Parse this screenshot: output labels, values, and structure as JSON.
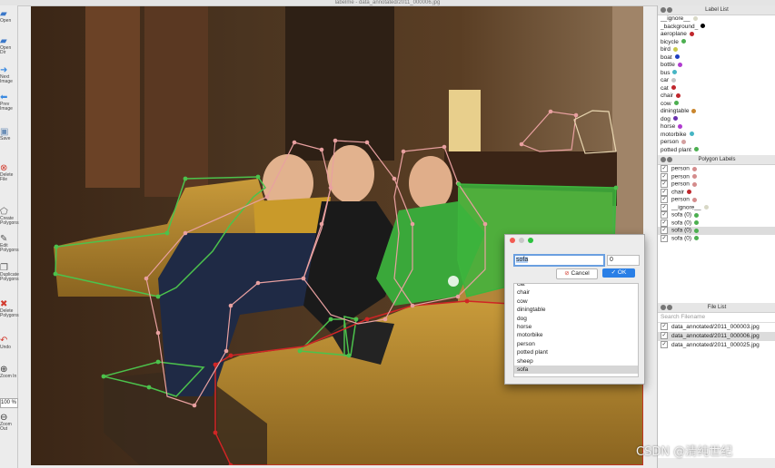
{
  "window": {
    "title": "labelme - data_annotated/2011_000006.jpg"
  },
  "toolbar": {
    "items": [
      {
        "label": "Open",
        "icon": "folder-icon",
        "color": "#3b78c9"
      },
      {
        "label": "Open Dir",
        "icon": "folder-icon",
        "color": "#3b78c9"
      },
      {
        "label": "Next Image",
        "icon": "arrow-right-icon",
        "color": "#3b8ae0"
      },
      {
        "label": "Prev Image",
        "icon": "arrow-left-icon",
        "color": "#3b8ae0"
      },
      {
        "label": "Save",
        "icon": "save-icon",
        "color": "#6c8fb7"
      },
      {
        "label": "Delete File",
        "icon": "delete-file-icon",
        "color": "#d23c2f"
      },
      {
        "label": "Create Polygons",
        "icon": "polygon-icon",
        "color": "#555"
      },
      {
        "label": "Edit Polygons",
        "icon": "edit-icon",
        "color": "#555"
      },
      {
        "label": "Duplicate Polygons",
        "icon": "copy-icon",
        "color": "#555"
      },
      {
        "label": "Delete Polygons",
        "icon": "cross-icon",
        "color": "#d23c2f"
      },
      {
        "label": "Undo",
        "icon": "undo-icon",
        "color": "#d23c2f"
      },
      {
        "label": "Zoom In",
        "icon": "zoom-in-icon",
        "color": "#333"
      },
      {
        "label": "Zoom Out",
        "icon": "zoom-out-icon",
        "color": "#333"
      }
    ],
    "zoom_value": "100 %"
  },
  "label_list": {
    "title": "Label List",
    "items": [
      {
        "label": "__ignore__",
        "color": "#d8d8c6"
      },
      {
        "label": "_background_",
        "color": "#000000"
      },
      {
        "label": "aeroplane",
        "color": "#c0272d"
      },
      {
        "label": "bicycle",
        "color": "#4caf50"
      },
      {
        "label": "bird",
        "color": "#c9c94a"
      },
      {
        "label": "boat",
        "color": "#1f3fbf"
      },
      {
        "label": "bottle",
        "color": "#b03bd0"
      },
      {
        "label": "bus",
        "color": "#46b5c4"
      },
      {
        "label": "car",
        "color": "#c4c4c4"
      },
      {
        "label": "cat",
        "color": "#c0272d"
      },
      {
        "label": "chair",
        "color": "#c0272d"
      },
      {
        "label": "cow",
        "color": "#4caf50"
      },
      {
        "label": "diningtable",
        "color": "#c9862d"
      },
      {
        "label": "dog",
        "color": "#6a2fae"
      },
      {
        "label": "horse",
        "color": "#b03bd0"
      },
      {
        "label": "motorbike",
        "color": "#46b5c4"
      },
      {
        "label": "person",
        "color": "#d4a0a0"
      },
      {
        "label": "potted plant",
        "color": "#4caf50"
      }
    ]
  },
  "polygon_labels": {
    "title": "Polygon Labels",
    "items": [
      {
        "label": "person",
        "color": "#d48c8c",
        "checked": true
      },
      {
        "label": "person",
        "color": "#d48c8c",
        "checked": true
      },
      {
        "label": "person",
        "color": "#d48c8c",
        "checked": true
      },
      {
        "label": "chair",
        "color": "#c0272d",
        "checked": true
      },
      {
        "label": "person",
        "color": "#d48c8c",
        "checked": true
      },
      {
        "label": "__ignore__",
        "color": "#d8d8c6",
        "checked": true
      },
      {
        "label": "sofa (0)",
        "color": "#4caf50",
        "checked": true
      },
      {
        "label": "sofa (0)",
        "color": "#4caf50",
        "checked": true
      },
      {
        "label": "sofa (0)",
        "color": "#4caf50",
        "checked": true,
        "selected": true
      },
      {
        "label": "sofa (0)",
        "color": "#4caf50",
        "checked": true
      }
    ]
  },
  "file_list": {
    "title": "File List",
    "search_placeholder": "Search Filename",
    "items": [
      {
        "label": "data_annotated/2011_000003.jpg",
        "checked": true
      },
      {
        "label": "data_annotated/2011_000006.jpg",
        "checked": true,
        "selected": true
      },
      {
        "label": "data_annotated/2011_000025.jpg",
        "checked": true
      }
    ]
  },
  "dialog": {
    "input_value": "sofa",
    "group_id": "0",
    "cancel_label": "Cancel",
    "ok_label": "OK",
    "options": [
      "cat",
      "chair",
      "cow",
      "diningtable",
      "dog",
      "horse",
      "motorbike",
      "person",
      "potted plant",
      "sheep",
      "sofa"
    ],
    "selected_option": "sofa"
  },
  "watermark": "CSDN @清纯世纪"
}
